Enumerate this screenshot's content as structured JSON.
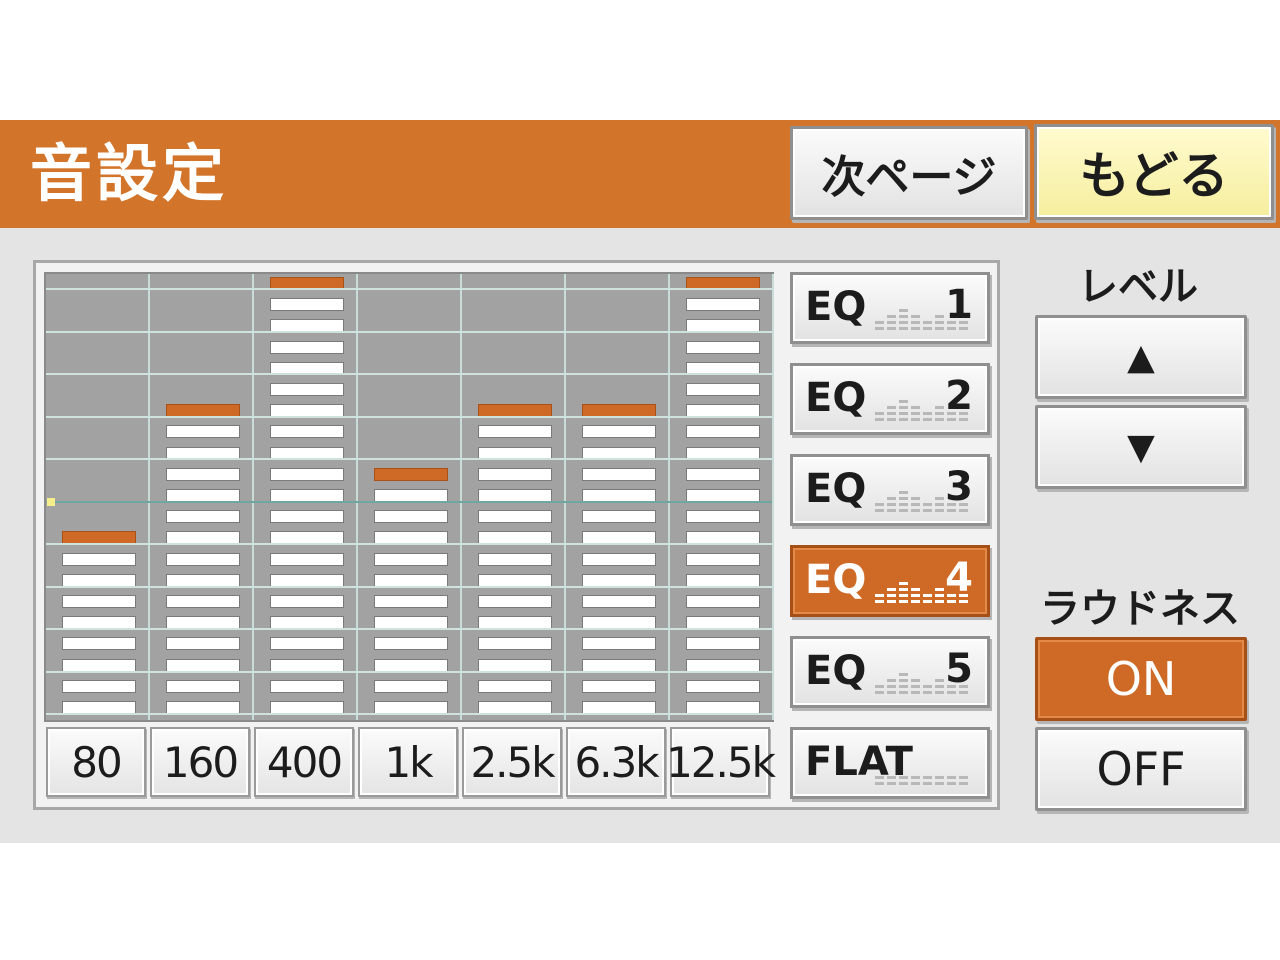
{
  "header": {
    "title": "音設定",
    "next_page_label": "次ページ",
    "back_label": "もどる"
  },
  "equalizer": {
    "segments_total": 20,
    "bands": [
      {
        "freq": "80",
        "level": 9
      },
      {
        "freq": "160",
        "level": 15
      },
      {
        "freq": "400",
        "level": 21
      },
      {
        "freq": "1k",
        "level": 12
      },
      {
        "freq": "2.5k",
        "level": 15
      },
      {
        "freq": "6.3k",
        "level": 15
      },
      {
        "freq": "12.5k",
        "level": 21
      }
    ]
  },
  "presets": [
    {
      "label": "EQ",
      "number": "1",
      "active": false
    },
    {
      "label": "EQ",
      "number": "2",
      "active": false
    },
    {
      "label": "EQ",
      "number": "3",
      "active": false
    },
    {
      "label": "EQ",
      "number": "4",
      "active": true
    },
    {
      "label": "EQ",
      "number": "5",
      "active": false
    },
    {
      "label": "FLAT",
      "number": "",
      "active": false
    }
  ],
  "level": {
    "label": "レベル",
    "up_icon": "▲",
    "down_icon": "▼"
  },
  "loudness": {
    "label": "ラウドネス",
    "on_label": "ON",
    "off_label": "OFF",
    "selected": "ON"
  },
  "colors": {
    "accent": "#d3742b",
    "active_button": "#cf6a26",
    "back_button": "#f6ee9e"
  }
}
